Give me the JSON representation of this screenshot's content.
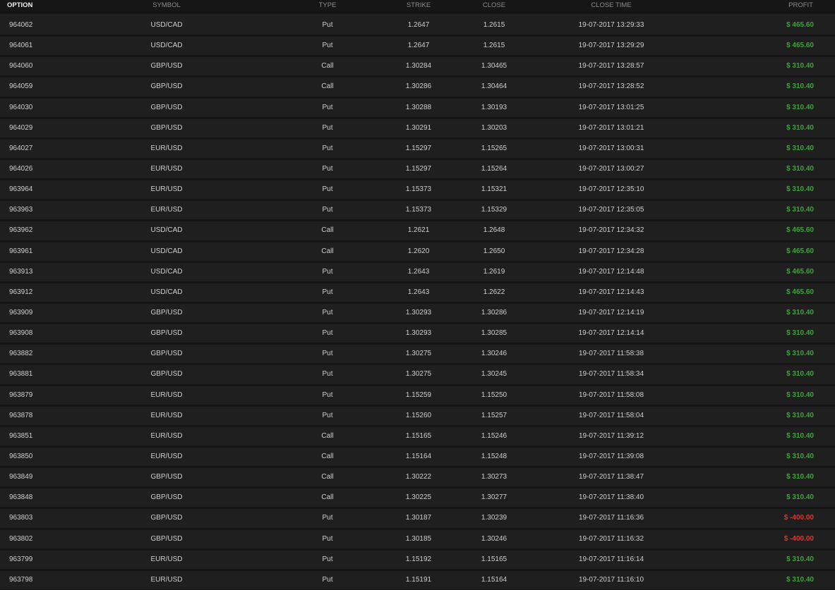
{
  "colors": {
    "background": "#1f1f1f",
    "header_background": "#161616",
    "profit_positive": "#3fa23c",
    "profit_negative": "#d23a33"
  },
  "header": {
    "option": "OPTION",
    "symbol": "SYMBOL",
    "type": "TYPE",
    "strike": "STRIKE",
    "close": "CLOSE",
    "close_time": "CLOSE TIME",
    "profit": "PROFIT"
  },
  "rows": [
    {
      "option": "964062",
      "symbol": "USD/CAD",
      "type": "Put",
      "strike": "1.2647",
      "close": "1.2615",
      "close_time": "19-07-2017 13:29:33",
      "profit": "$ 465.60",
      "profit_sign": "pos"
    },
    {
      "option": "964061",
      "symbol": "USD/CAD",
      "type": "Put",
      "strike": "1.2647",
      "close": "1.2615",
      "close_time": "19-07-2017 13:29:29",
      "profit": "$ 465.60",
      "profit_sign": "pos"
    },
    {
      "option": "964060",
      "symbol": "GBP/USD",
      "type": "Call",
      "strike": "1.30284",
      "close": "1.30465",
      "close_time": "19-07-2017 13:28:57",
      "profit": "$ 310.40",
      "profit_sign": "pos"
    },
    {
      "option": "964059",
      "symbol": "GBP/USD",
      "type": "Call",
      "strike": "1.30286",
      "close": "1.30464",
      "close_time": "19-07-2017 13:28:52",
      "profit": "$ 310.40",
      "profit_sign": "pos"
    },
    {
      "option": "964030",
      "symbol": "GBP/USD",
      "type": "Put",
      "strike": "1.30288",
      "close": "1.30193",
      "close_time": "19-07-2017 13:01:25",
      "profit": "$ 310.40",
      "profit_sign": "pos"
    },
    {
      "option": "964029",
      "symbol": "GBP/USD",
      "type": "Put",
      "strike": "1.30291",
      "close": "1.30203",
      "close_time": "19-07-2017 13:01:21",
      "profit": "$ 310.40",
      "profit_sign": "pos"
    },
    {
      "option": "964027",
      "symbol": "EUR/USD",
      "type": "Put",
      "strike": "1.15297",
      "close": "1.15265",
      "close_time": "19-07-2017 13:00:31",
      "profit": "$ 310.40",
      "profit_sign": "pos"
    },
    {
      "option": "964026",
      "symbol": "EUR/USD",
      "type": "Put",
      "strike": "1.15297",
      "close": "1.15264",
      "close_time": "19-07-2017 13:00:27",
      "profit": "$ 310.40",
      "profit_sign": "pos"
    },
    {
      "option": "963964",
      "symbol": "EUR/USD",
      "type": "Put",
      "strike": "1.15373",
      "close": "1.15321",
      "close_time": "19-07-2017 12:35:10",
      "profit": "$ 310.40",
      "profit_sign": "pos"
    },
    {
      "option": "963963",
      "symbol": "EUR/USD",
      "type": "Put",
      "strike": "1.15373",
      "close": "1.15329",
      "close_time": "19-07-2017 12:35:05",
      "profit": "$ 310.40",
      "profit_sign": "pos"
    },
    {
      "option": "963962",
      "symbol": "USD/CAD",
      "type": "Call",
      "strike": "1.2621",
      "close": "1.2648",
      "close_time": "19-07-2017 12:34:32",
      "profit": "$ 465.60",
      "profit_sign": "pos"
    },
    {
      "option": "963961",
      "symbol": "USD/CAD",
      "type": "Call",
      "strike": "1.2620",
      "close": "1.2650",
      "close_time": "19-07-2017 12:34:28",
      "profit": "$ 465.60",
      "profit_sign": "pos"
    },
    {
      "option": "963913",
      "symbol": "USD/CAD",
      "type": "Put",
      "strike": "1.2643",
      "close": "1.2619",
      "close_time": "19-07-2017 12:14:48",
      "profit": "$ 465.60",
      "profit_sign": "pos"
    },
    {
      "option": "963912",
      "symbol": "USD/CAD",
      "type": "Put",
      "strike": "1.2643",
      "close": "1.2622",
      "close_time": "19-07-2017 12:14:43",
      "profit": "$ 465.60",
      "profit_sign": "pos"
    },
    {
      "option": "963909",
      "symbol": "GBP/USD",
      "type": "Put",
      "strike": "1.30293",
      "close": "1.30286",
      "close_time": "19-07-2017 12:14:19",
      "profit": "$ 310.40",
      "profit_sign": "pos"
    },
    {
      "option": "963908",
      "symbol": "GBP/USD",
      "type": "Put",
      "strike": "1.30293",
      "close": "1.30285",
      "close_time": "19-07-2017 12:14:14",
      "profit": "$ 310.40",
      "profit_sign": "pos"
    },
    {
      "option": "963882",
      "symbol": "GBP/USD",
      "type": "Put",
      "strike": "1.30275",
      "close": "1.30246",
      "close_time": "19-07-2017 11:58:38",
      "profit": "$ 310.40",
      "profit_sign": "pos"
    },
    {
      "option": "963881",
      "symbol": "GBP/USD",
      "type": "Put",
      "strike": "1.30275",
      "close": "1.30245",
      "close_time": "19-07-2017 11:58:34",
      "profit": "$ 310.40",
      "profit_sign": "pos"
    },
    {
      "option": "963879",
      "symbol": "EUR/USD",
      "type": "Put",
      "strike": "1.15259",
      "close": "1.15250",
      "close_time": "19-07-2017 11:58:08",
      "profit": "$ 310.40",
      "profit_sign": "pos"
    },
    {
      "option": "963878",
      "symbol": "EUR/USD",
      "type": "Put",
      "strike": "1.15260",
      "close": "1.15257",
      "close_time": "19-07-2017 11:58:04",
      "profit": "$ 310.40",
      "profit_sign": "pos"
    },
    {
      "option": "963851",
      "symbol": "EUR/USD",
      "type": "Call",
      "strike": "1.15165",
      "close": "1.15246",
      "close_time": "19-07-2017 11:39:12",
      "profit": "$ 310.40",
      "profit_sign": "pos"
    },
    {
      "option": "963850",
      "symbol": "EUR/USD",
      "type": "Call",
      "strike": "1.15164",
      "close": "1.15248",
      "close_time": "19-07-2017 11:39:08",
      "profit": "$ 310.40",
      "profit_sign": "pos"
    },
    {
      "option": "963849",
      "symbol": "GBP/USD",
      "type": "Call",
      "strike": "1.30222",
      "close": "1.30273",
      "close_time": "19-07-2017 11:38:47",
      "profit": "$ 310.40",
      "profit_sign": "pos"
    },
    {
      "option": "963848",
      "symbol": "GBP/USD",
      "type": "Call",
      "strike": "1.30225",
      "close": "1.30277",
      "close_time": "19-07-2017 11:38:40",
      "profit": "$ 310.40",
      "profit_sign": "pos"
    },
    {
      "option": "963803",
      "symbol": "GBP/USD",
      "type": "Put",
      "strike": "1.30187",
      "close": "1.30239",
      "close_time": "19-07-2017 11:16:36",
      "profit": "$ -400.00",
      "profit_sign": "neg"
    },
    {
      "option": "963802",
      "symbol": "GBP/USD",
      "type": "Put",
      "strike": "1.30185",
      "close": "1.30246",
      "close_time": "19-07-2017 11:16:32",
      "profit": "$ -400.00",
      "profit_sign": "neg"
    },
    {
      "option": "963799",
      "symbol": "EUR/USD",
      "type": "Put",
      "strike": "1.15192",
      "close": "1.15165",
      "close_time": "19-07-2017 11:16:14",
      "profit": "$ 310.40",
      "profit_sign": "pos"
    },
    {
      "option": "963798",
      "symbol": "EUR/USD",
      "type": "Put",
      "strike": "1.15191",
      "close": "1.15164",
      "close_time": "19-07-2017 11:16:10",
      "profit": "$ 310.40",
      "profit_sign": "pos"
    }
  ]
}
